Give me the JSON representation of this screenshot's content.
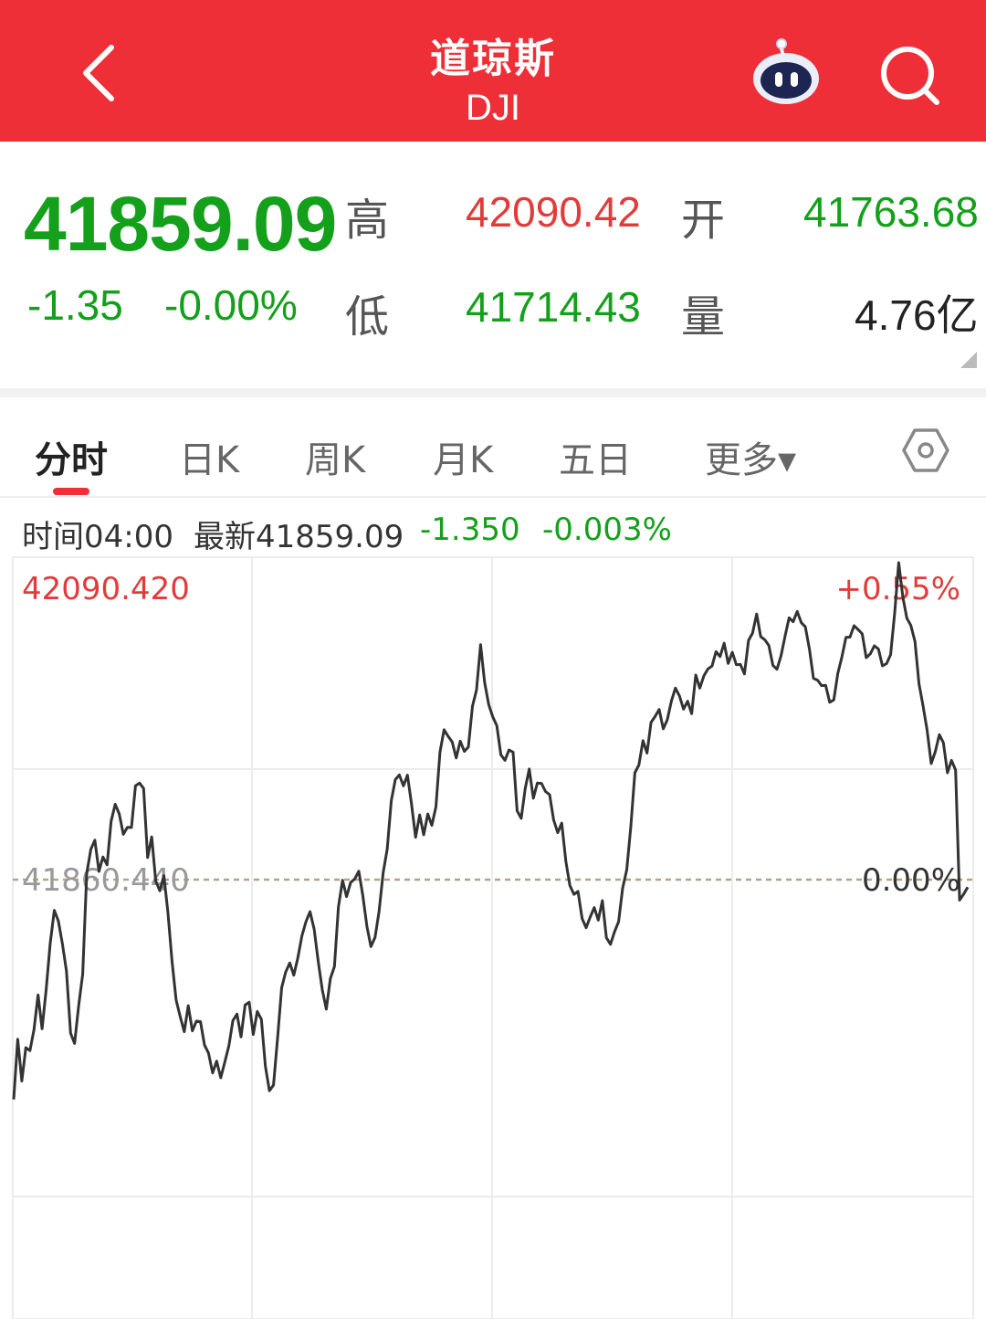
{
  "header": {
    "title": "道琼斯",
    "subtitle": "DJI",
    "icons": {
      "back": "chevron-left-icon",
      "assistant": "robot-icon",
      "search": "search-icon"
    },
    "bg_color": "#ee2f37"
  },
  "quote": {
    "price": "41859.09",
    "change": "-1.35",
    "change_pct": "-0.00%",
    "high_label": "高",
    "high": "42090.42",
    "open_label": "开",
    "open": "41763.68",
    "low_label": "低",
    "low": "41714.43",
    "volume_label": "量",
    "volume": "4.76亿"
  },
  "tabs": [
    {
      "label": "分时",
      "active": true
    },
    {
      "label": "日K"
    },
    {
      "label": "周K"
    },
    {
      "label": "月K"
    },
    {
      "label": "五日"
    },
    {
      "label": "更多▾"
    }
  ],
  "infobar": {
    "time_label": "时间04:00",
    "latest_label": "最新41859.09",
    "change": "-1.350",
    "change_pct": "-0.003%"
  },
  "colors": {
    "up": "#e23b3b",
    "down": "#14a01b",
    "line": "#333333"
  },
  "chart_data": {
    "type": "line",
    "max_price_label": "42090.420",
    "max_pct_label": "+0.55%",
    "base_price_label": "41860.440",
    "base_pct_label": "0.00%",
    "base_price": 41860.44,
    "ylim": [
      41600.0,
      42090.42
    ],
    "grid": true,
    "series": [
      {
        "values": [
          41701.0,
          41744.6,
          41714.3,
          41738.6,
          41736.4,
          41751.5,
          41776.8,
          41752.2,
          41780.9,
          41814.3,
          41838.2,
          41830.5,
          41813.7,
          41794.1,
          41749.1,
          41741.6,
          41768.6,
          41792.0,
          41865.1,
          41882.5,
          41889.1,
          41866.4,
          41876.9,
          41871.2,
          41902.8,
          41915.1,
          41908.2,
          41893.3,
          41898.4,
          41898.3,
          41928.6,
          41930.5,
          41926.6,
          41876.5,
          41891.5,
          41859.3,
          41852.4,
          41863.4,
          41836.2,
          41801.5,
          41773.2,
          41761.3,
          41750.1,
          41769.0,
          41750.8,
          41757.8,
          41757.4,
          41740.4,
          41734.6,
          41720.2,
          41728.8,
          41716.7,
          41728.0,
          41739.9,
          41758.2,
          41762.9,
          41746.4,
          41769.5,
          41771.5,
          41748.1,
          41764.8,
          41759.1,
          41725.0,
          41707.3,
          41711.4,
          41745.2,
          41782.0,
          41793.3,
          41800.0,
          41791.1,
          41803.9,
          41819.7,
          41830.1,
          41837.2,
          41824.5,
          41801.4,
          41780.6,
          41766.5,
          41788.8,
          41797.3,
          41840.7,
          41860.0,
          41848.1,
          41858.4,
          41860.9,
          41866.6,
          41848.9,
          41826.5,
          41811.9,
          41818.6,
          41837.3,
          41865.5,
          41882.5,
          41917.7,
          41933.0,
          41936.4,
          41928.5,
          41936.3,
          41915.1,
          41891.2,
          41907.4,
          41893.0,
          41908.1,
          41899.8,
          41913.3,
          41952.9,
          41969.2,
          41964.5,
          41960.4,
          41948.7,
          41961.0,
          41953.5,
          41956.6,
          41986.3,
          41997.9,
          42031.0,
          42003.7,
          41987.5,
          41978.7,
          41972.1,
          41951.1,
          41947.0,
          41954.5,
          41953.0,
          41910.4,
          41904.9,
          41926.6,
          41940.7,
          41919.5,
          41930.5,
          41930.3,
          41924.4,
          41922.1,
          41903.8,
          41894.5,
          41901.5,
          41873.7,
          41856.2,
          41849.8,
          41851.9,
          41832.3,
          41825.6,
          41833.2,
          41840.2,
          41831.1,
          41845.2,
          41818.3,
          41813.5,
          41822.6,
          41830.0,
          41854.3,
          41867.6,
          41898.5,
          41938.0,
          41943.6,
          41961.3,
          41952.3,
          41974.5,
          41978.9,
          41983.9,
          41969.9,
          41976.4,
          41990.0,
          41999.4,
          41993.6,
          41984.2,
          41989.9,
          41980.9,
          42008.9,
          41999.4,
          42008.3,
          42013.3,
          42015.4,
          42025.9,
          42022.3,
          42032.0,
          42017.3,
          42025.4,
          42016.4,
          42016.6,
          42009.7,
          42034.0,
          42039.3,
          42053.2,
          42036.8,
          42034.5,
          42030.4,
          42015.9,
          42013.1,
          42022.6,
          42037.1,
          42050.4,
          42047.6,
          42055.0,
          42046.9,
          42043.9,
          42027.7,
          42006.5,
          42005.2,
          42001.2,
          42001.4,
          41989.1,
          41990.9,
          42010.1,
          42021.8,
          42036.2,
          42036.4,
          42044.7,
          42041.9,
          42038.8,
          42021.5,
          42024.3,
          42030.1,
          42027.7,
          42015.5,
          42017.2,
          42023.6,
          42054.1,
          42090.4,
          42065.6,
          42050.1,
          42044.9,
          42033.3,
          42002.6,
          41986.4,
          41968.9,
          41944.7,
          41953.2,
          41965.6,
          41959.8,
          41938.0,
          41947.0,
          41940.0,
          41845.6,
          41850.0,
          41855.0
        ]
      }
    ]
  }
}
